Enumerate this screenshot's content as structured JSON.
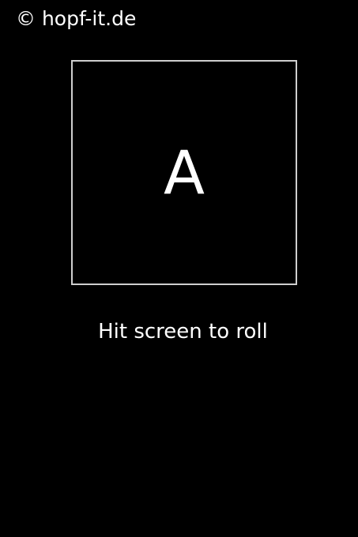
{
  "header": {
    "copyright": "© hopf-it.de"
  },
  "die": {
    "face": "A"
  },
  "hint": {
    "text": "Hit screen to roll"
  },
  "colors": {
    "background": "#000000",
    "text": "#ffffff",
    "frame_border": "#cfcfcf"
  }
}
